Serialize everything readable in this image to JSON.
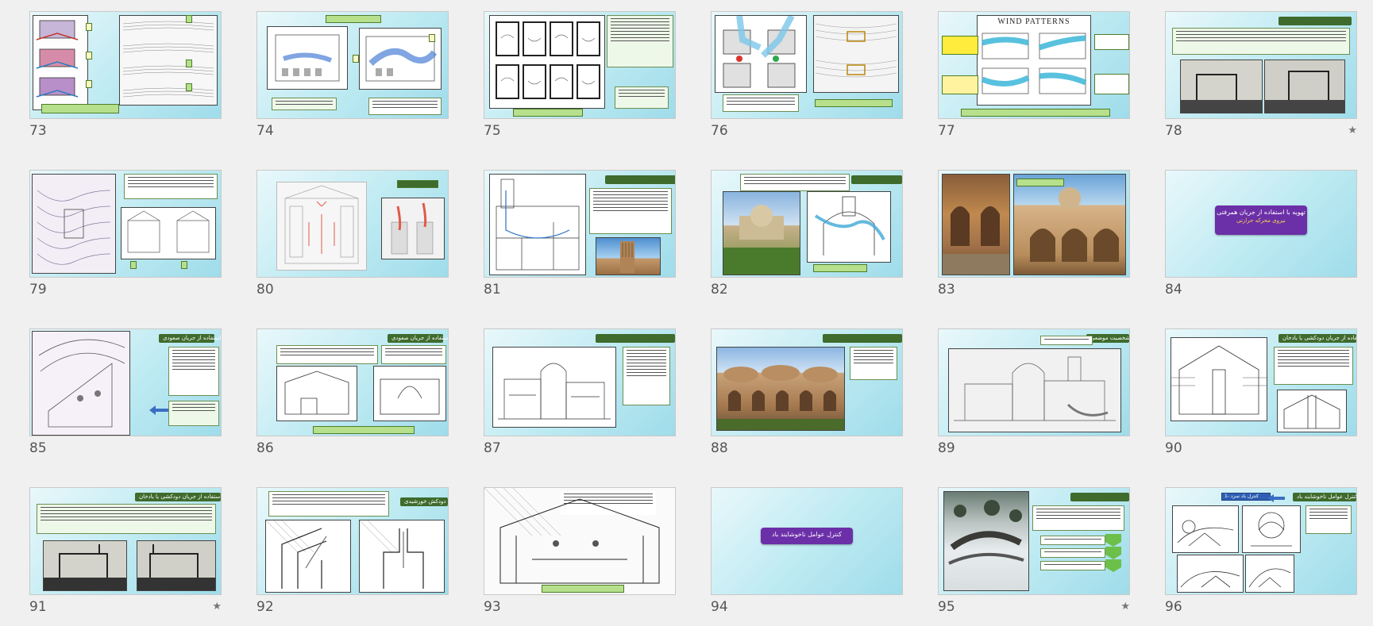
{
  "view": "slide-sorter",
  "slides": [
    {
      "number": "73",
      "star": false
    },
    {
      "number": "74",
      "star": false
    },
    {
      "number": "75",
      "star": false
    },
    {
      "number": "76",
      "star": false
    },
    {
      "number": "77",
      "star": false,
      "heading": "WIND PATTERNS"
    },
    {
      "number": "78",
      "star": true
    },
    {
      "number": "79",
      "star": false
    },
    {
      "number": "80",
      "star": false
    },
    {
      "number": "81",
      "star": false
    },
    {
      "number": "82",
      "star": false
    },
    {
      "number": "83",
      "star": false
    },
    {
      "number": "84",
      "star": false,
      "title": "تهویه با استفاده از جریان همرفتی",
      "subtitle": "نیروی محرکه حرارتی"
    },
    {
      "number": "85",
      "star": false,
      "title": "استفاده از جریان صعودی"
    },
    {
      "number": "86",
      "star": false,
      "title": "استفاده از جریان صعودی"
    },
    {
      "number": "87",
      "star": false
    },
    {
      "number": "88",
      "star": false
    },
    {
      "number": "89",
      "star": false,
      "title": "شخصیت موضعی"
    },
    {
      "number": "90",
      "star": false,
      "title": "استفاده از جریان دودکشی یا بادخان"
    },
    {
      "number": "91",
      "star": true,
      "title": "استفاده از جریان دودکشی یا بادخان"
    },
    {
      "number": "92",
      "star": false,
      "title": "دودکش خورشیدی"
    },
    {
      "number": "93",
      "star": false
    },
    {
      "number": "94",
      "star": false,
      "title": "کنترل عوامل ناخوشایند باد"
    },
    {
      "number": "95",
      "star": true
    },
    {
      "number": "96",
      "star": false,
      "title": "کنترل عوامل ناخوشایند باد",
      "subtitle": "1- کنترل باد سرد"
    }
  ],
  "icons": {
    "star": "star-icon"
  },
  "colors": {
    "slide_bg": "#bdeaf2",
    "title_tag": "#3f6b2d",
    "label_tag": "#b6e08c",
    "section_title": "#6b2fa8"
  }
}
